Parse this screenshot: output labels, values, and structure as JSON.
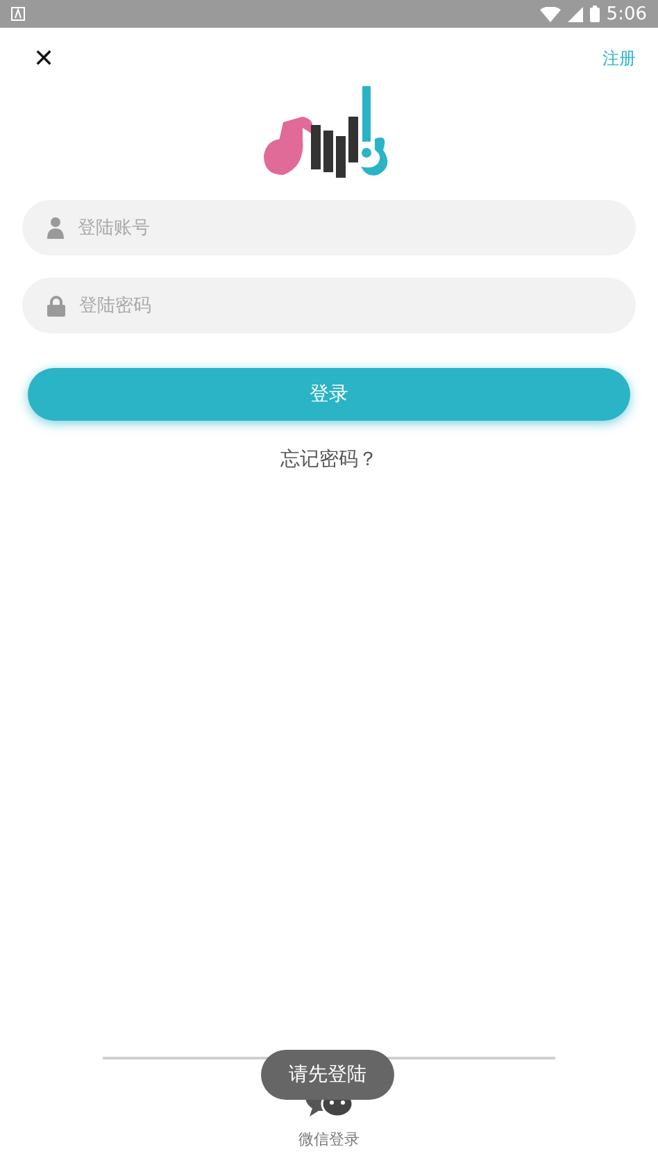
{
  "status_bar": {
    "time": "5:06"
  },
  "header": {
    "close": "✕",
    "register": "注册"
  },
  "fields": [
    {
      "kind": "user",
      "placeholder": "登陆账号"
    },
    {
      "kind": "password",
      "placeholder": "登陆密码"
    }
  ],
  "login_button": "登录",
  "forgot_link": "忘记密码？",
  "toast": "请先登陆",
  "social": [
    {
      "label": "微信登录"
    }
  ]
}
